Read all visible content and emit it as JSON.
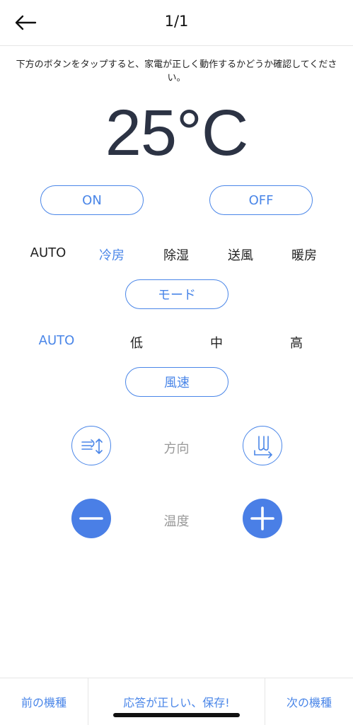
{
  "header": {
    "back_icon": "arrow-left-icon",
    "title": "1/1"
  },
  "instruction": "下方のボタンをタップすると、家電が正しく動作するかどうか確認してください。",
  "temperature": "25°C",
  "power": {
    "on_label": "ON",
    "off_label": "OFF"
  },
  "modes": {
    "items": [
      "AUTO",
      "冷房",
      "除湿",
      "送風",
      "暖房"
    ],
    "selected": "冷房",
    "button_label": "モード"
  },
  "fan": {
    "items": [
      "AUTO",
      "低",
      "中",
      "高"
    ],
    "selected": "AUTO",
    "button_label": "風速"
  },
  "direction": {
    "label": "方向",
    "left_icon": "horizontal-swing-icon",
    "right_icon": "vertical-swing-icon"
  },
  "temp_control": {
    "label": "温度",
    "minus_icon": "minus-icon",
    "plus_icon": "plus-icon"
  },
  "footer": {
    "prev_label": "前の機種",
    "save_label": "応答が正しい、保存!",
    "next_label": "次の機種"
  },
  "colors": {
    "accent": "#4a86e8",
    "text_dark": "#2c3344",
    "muted": "#999999"
  }
}
